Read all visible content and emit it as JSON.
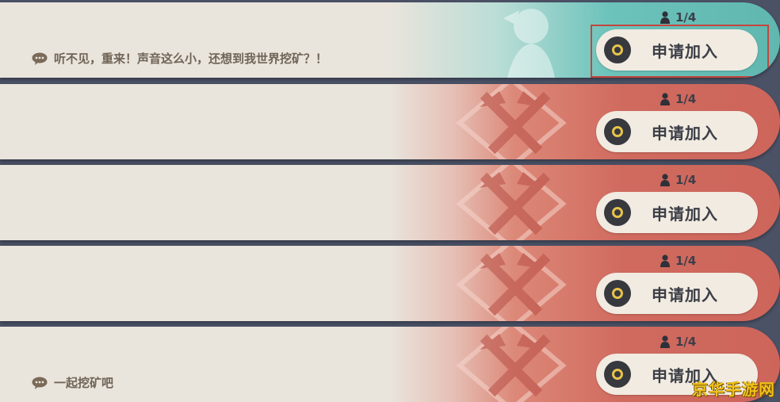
{
  "rows": [
    {
      "message": "听不见，重来！声音这么小，还想到我世界挖矿？！",
      "count": "1/4",
      "join_label": "申请加入",
      "theme": "teal"
    },
    {
      "message": "",
      "count": "1/4",
      "join_label": "申请加入",
      "theme": "red"
    },
    {
      "message": "",
      "count": "1/4",
      "join_label": "申请加入",
      "theme": "red"
    },
    {
      "message": "",
      "count": "1/4",
      "join_label": "申请加入",
      "theme": "red"
    },
    {
      "message": "一起挖矿吧",
      "count": "1/4",
      "join_label": "申请加入",
      "theme": "red"
    }
  ],
  "icons": {
    "chat": "chat-bubble-icon",
    "player": "person-icon",
    "join": "join-ring-icon"
  },
  "colors": {
    "teal_accent": "#5fb7b0",
    "red_accent": "#cd655b",
    "highlight_box": "#c4453d",
    "watermark": "#f2c21a"
  },
  "watermark": "京华手游网"
}
